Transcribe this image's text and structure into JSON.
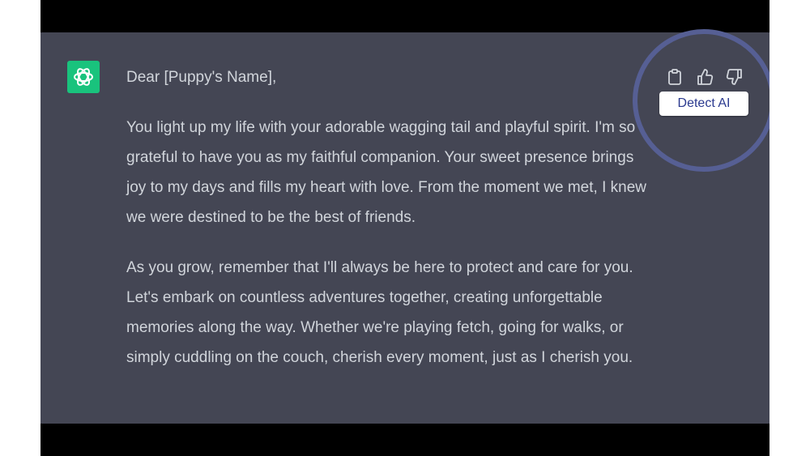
{
  "message": {
    "greeting": "Dear [Puppy's Name],",
    "paragraph1": "You light up my life with your adorable wagging tail and playful spirit. I'm so grateful to have you as my faithful companion. Your sweet presence brings joy to my days and fills my heart with love. From the moment we met, I knew we were destined to be the best of friends.",
    "paragraph2": "As you grow, remember that I'll always be here to protect and care for you. Let's embark on countless adventures together, creating unforgettable memories along the way. Whether we're playing fetch, going for walks, or simply cuddling on the couch, cherish every moment, just as I cherish you."
  },
  "actions": {
    "copy_icon": "clipboard-icon",
    "like_icon": "thumbs-up-icon",
    "dislike_icon": "thumbs-down-icon",
    "detect_label": "Detect AI"
  },
  "colors": {
    "chat_background": "#444654",
    "avatar_green": "#19c37d",
    "highlight_ring": "#565f94",
    "detect_text": "#2b3a8f"
  }
}
